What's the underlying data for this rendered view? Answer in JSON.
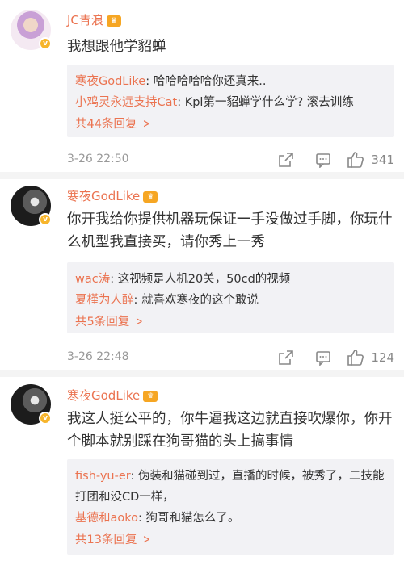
{
  "comments": [
    {
      "user": "JC青浪",
      "text": "我想跟他学貂蝉",
      "replies": [
        {
          "who": "寒夜GodLike",
          "text": ": 哈哈哈哈哈你还真来.."
        },
        {
          "who": "小鸡灵永远支持Cat",
          "text": ": Kpl第一貂蝉学什么学? 滚去训练"
        }
      ],
      "more": "共44条回复",
      "time": "3-26 22:50",
      "likes": "341"
    },
    {
      "user": "寒夜GodLike",
      "text": "你开我给你提供机器玩保证一手没做过手脚，你玩什么机型我直接买，请你秀上一秀",
      "replies": [
        {
          "who": "wac涛",
          "text": ": 这视频是人机20关，50cd的视频"
        },
        {
          "who": "夏槿为人醉",
          "text": ": 就喜欢寒夜的这个敢说"
        }
      ],
      "more": "共5条回复",
      "time": "3-26 22:48",
      "likes": "124"
    },
    {
      "user": "寒夜GodLike",
      "text": "我这人挺公平的，你牛逼我这边就直接吹爆你，你开个脚本就别踩在狗哥猫的头上搞事情",
      "replies": [
        {
          "who": "fish-yu-er",
          "text": ": 伪装和猫碰到过，直播的时候，被秀了，二技能打团和没CD一样，"
        },
        {
          "who": "基德和aoko",
          "text": ": 狗哥和猫怎么了。"
        }
      ],
      "more": "共13条回复"
    }
  ],
  "icons": {
    "share": "share-icon",
    "comment": "comment-icon",
    "like": "thumbs-up-icon",
    "verified": "verified-badge-icon",
    "level": "level-badge-icon"
  },
  "colors": {
    "username": "#eb7350",
    "reply_bg": "#f2f2f5",
    "meta": "#999999"
  }
}
